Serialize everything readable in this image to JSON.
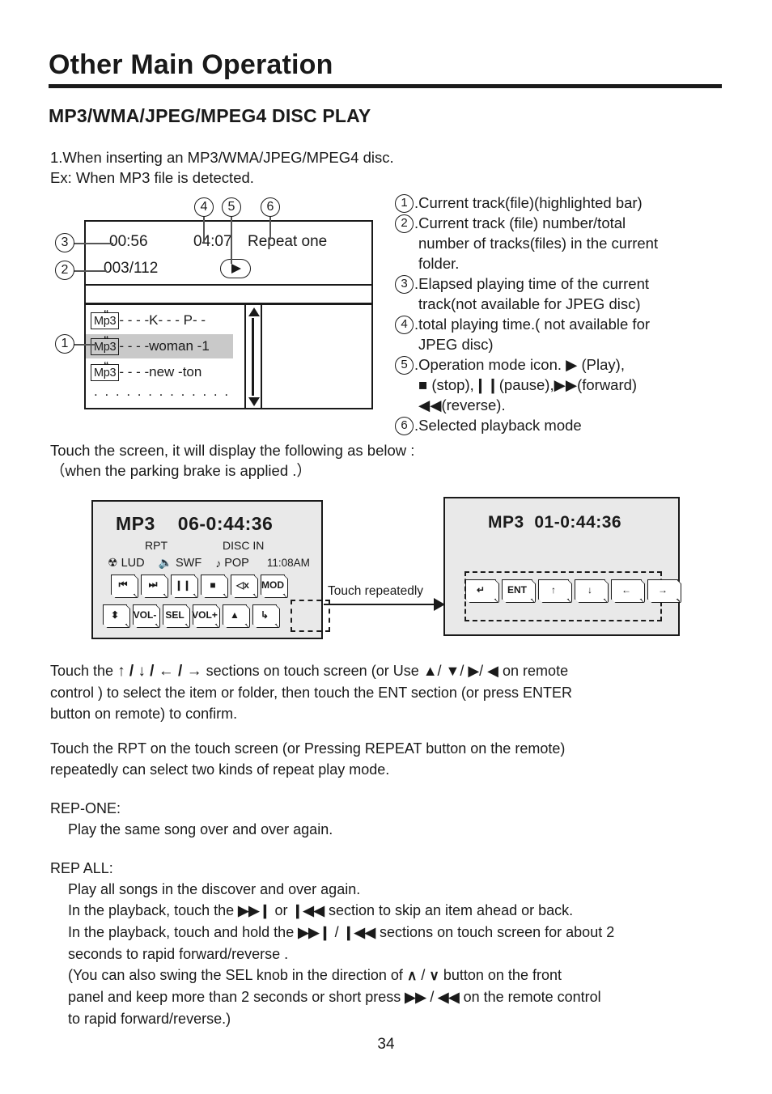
{
  "document": {
    "title": "Other Main Operation",
    "section_title": "MP3/WMA/JPEG/MPEG4 DISC PLAY",
    "page_number": "34"
  },
  "intro": {
    "line1": "1.When inserting an MP3/WMA/JPEG/MPEG4 disc.",
    "line2": "Ex: When MP3 file is detected."
  },
  "screen_mock": {
    "elapsed_time": "00:56",
    "total_time": "04:07",
    "playback_mode": "Repeat one",
    "track_number": "003/112",
    "play_icon": "play-icon",
    "files": [
      {
        "badge": "Mp3",
        "name": "- - - -K- - - P- -",
        "highlighted": false
      },
      {
        "badge": "Mp3",
        "name": "- - - -woman -1",
        "highlighted": true
      },
      {
        "badge": "Mp3",
        "name": "- - - -new -ton",
        "highlighted": false
      }
    ],
    "more_indicator": ". . . . . . . . . . . . .",
    "callouts": [
      "1",
      "2",
      "3",
      "4",
      "5",
      "6"
    ]
  },
  "legend": {
    "items": [
      {
        "num": "1",
        "text": ".Current track(file)(highlighted bar)",
        "cont": []
      },
      {
        "num": "2",
        "text": ".Current track (file) number/total",
        "cont": [
          "number of tracks(files) in the current",
          "folder."
        ]
      },
      {
        "num": "3",
        "text": ".Elapsed playing time of the current",
        "cont": [
          "track(not available for JPEG disc)"
        ]
      },
      {
        "num": "4",
        "text": ".total playing time.( not available for",
        "cont": [
          "JPEG disc)"
        ]
      },
      {
        "num": "5",
        "text": ".Operation mode icon.  ▶ (Play),",
        "cont": [
          "■ (stop),❙❙(pause),▶▶(forward)",
          "◀◀(reverse)."
        ]
      },
      {
        "num": "6",
        "text": ".Selected playback mode",
        "cont": []
      }
    ]
  },
  "touchscreen_intro": {
    "line1": "Touch the screen, it will display the following as below :",
    "line2": "（when the parking brake is applied .）"
  },
  "touch_panel_left": {
    "source_label": "MP3",
    "time": "06-0:44:36",
    "rpt_label": "RPT",
    "disc_label": "DISC IN",
    "loudness_icon": "loudness-icon",
    "loudness_label": "LUD",
    "subwoofer_icon": "speaker-icon",
    "subwoofer_label": "SWF",
    "eq_icon": "music-note-icon",
    "eq_label": "POP",
    "clock": "11:08AM",
    "buttons_row1": [
      {
        "name": "previous-track-button",
        "glyph": "⏮"
      },
      {
        "name": "next-track-button",
        "glyph": "⏭"
      },
      {
        "name": "pause-button",
        "glyph": "❙❙"
      },
      {
        "name": "stop-button",
        "glyph": "■"
      },
      {
        "name": "mute-button",
        "glyph": "◁x"
      },
      {
        "name": "mode-button",
        "glyph": "MOD"
      }
    ],
    "buttons_row2": [
      {
        "name": "updown-button",
        "glyph": "⬍"
      },
      {
        "name": "volume-down-button",
        "glyph": "VOL-"
      },
      {
        "name": "select-button",
        "glyph": "SEL"
      },
      {
        "name": "volume-up-button",
        "glyph": "VOL+"
      },
      {
        "name": "eject-button",
        "glyph": "▲"
      },
      {
        "name": "enter-loop-button",
        "glyph": "↳"
      }
    ]
  },
  "touch_panel_right": {
    "source_label": "MP3",
    "time": "01-0:44:36",
    "buttons": [
      {
        "name": "return-button",
        "glyph": "↵"
      },
      {
        "name": "enter-button",
        "glyph": "ENT"
      },
      {
        "name": "up-button",
        "glyph": "↑"
      },
      {
        "name": "down-button",
        "glyph": "↓"
      },
      {
        "name": "left-button",
        "glyph": "←"
      },
      {
        "name": "right-button",
        "glyph": "→"
      }
    ]
  },
  "connector": {
    "label": "Touch repeatedly"
  },
  "paragraphs": {
    "nav": {
      "l1_a": "Touch the ",
      "l1_arrows": "↑ / ↓ / ← / →",
      "l1_b": "  sections on touch screen (or Use ▲/ ▼/ ▶/ ◀ on remote",
      "l2": "control ) to select the item or folder, then touch the ENT section (or press ENTER",
      "l3": "button on remote) to confirm."
    },
    "rpt": {
      "l1": "Touch the RPT on the touch screen (or Pressing REPEAT button on the remote)",
      "l2": "repeatedly can select two kinds of repeat play mode."
    },
    "rep_one": {
      "heading": "REP-ONE:",
      "l1": " Play the same song over and over again."
    },
    "rep_all": {
      "heading": "REP ALL:",
      "l1": "Play all songs in the discover and over again.",
      "l2_a": "In the playback, touch the ",
      "l2_ff": "▶▶❙",
      "l2_b": " or ",
      "l2_rr": "❙◀◀",
      "l2_c": " section to skip an item ahead or back.",
      "l3_a": "In the playback, touch and hold the ",
      "l3_ff": "▶▶❙",
      "l3_b": " / ",
      "l3_rr": "❙◀◀",
      "l3_c": " sections on touch screen for about 2",
      "l4": "seconds to rapid forward/reverse .",
      "l5_a": "(You can also swing the SEL knob in the direction of ",
      "l5_up": "∧",
      "l5_b": " / ",
      "l5_dn": "∨",
      "l5_c": " button on the front",
      "l6_a": "panel and keep more than 2 seconds  or short press ",
      "l6_ff": "▶▶",
      "l6_b": " / ",
      "l6_rr": "◀◀",
      "l6_c": " on the remote control",
      "l7": "to rapid forward/reverse.)"
    }
  },
  "colors": {
    "ink": "#1a1a1a",
    "panel_bg": "#e9e9e9",
    "highlight_bar": "#c9c9c9"
  }
}
